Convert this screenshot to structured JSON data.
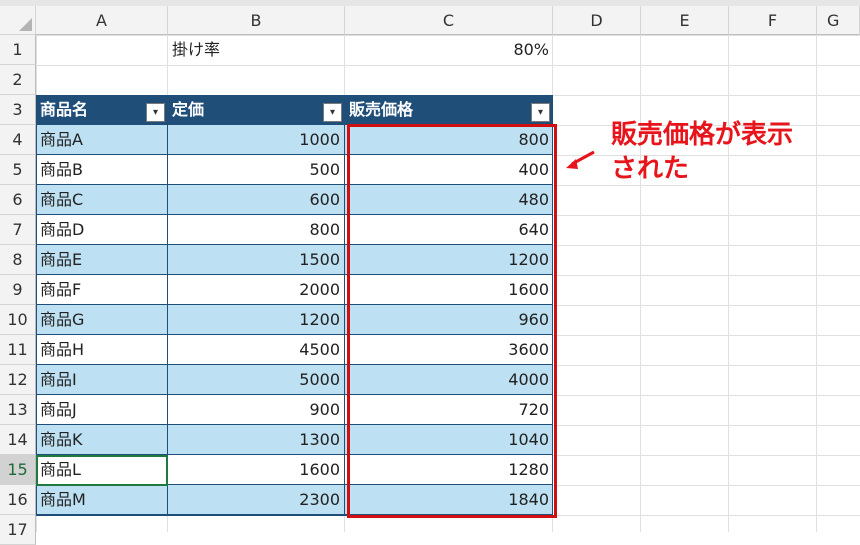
{
  "columns": [
    "A",
    "B",
    "C",
    "D",
    "E",
    "F",
    "G"
  ],
  "rows": [
    "1",
    "2",
    "3",
    "4",
    "5",
    "6",
    "7",
    "8",
    "9",
    "10",
    "11",
    "12",
    "13",
    "14",
    "15",
    "16",
    "17"
  ],
  "rate_label": "掛け率",
  "rate_value": "80%",
  "table": {
    "headers": [
      "商品名",
      "定価",
      "販売価格"
    ],
    "filter_glyph": "▾",
    "rows": [
      [
        "商品A",
        "1000",
        "800"
      ],
      [
        "商品B",
        "500",
        "400"
      ],
      [
        "商品C",
        "600",
        "480"
      ],
      [
        "商品D",
        "800",
        "640"
      ],
      [
        "商品E",
        "1500",
        "1200"
      ],
      [
        "商品F",
        "2000",
        "1600"
      ],
      [
        "商品G",
        "1200",
        "960"
      ],
      [
        "商品H",
        "4500",
        "3600"
      ],
      [
        "商品I",
        "5000",
        "4000"
      ],
      [
        "商品J",
        "900",
        "720"
      ],
      [
        "商品K",
        "1300",
        "1040"
      ],
      [
        "商品L",
        "1600",
        "1280"
      ],
      [
        "商品M",
        "2300",
        "1840"
      ]
    ]
  },
  "annotation": {
    "line1": "販売価格が表示",
    "line2": "された",
    "color": "#e8141c"
  },
  "selected_row": "15"
}
